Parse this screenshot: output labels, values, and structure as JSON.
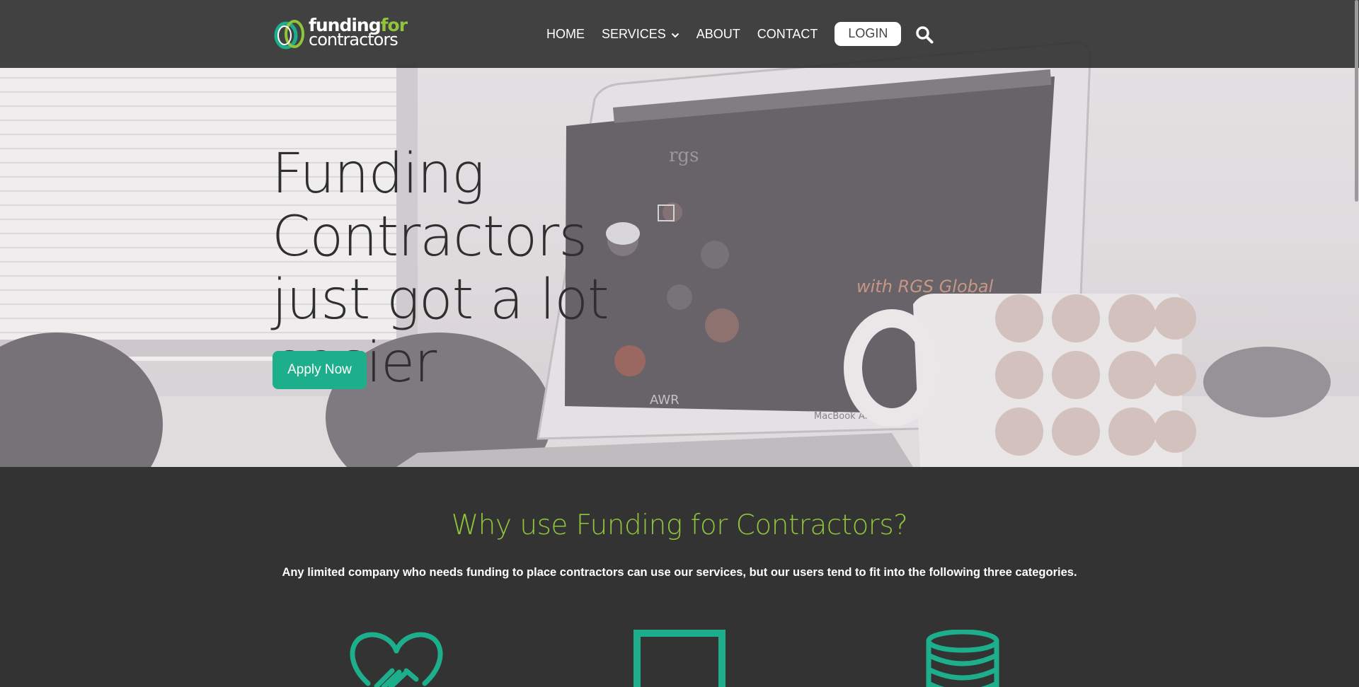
{
  "header": {
    "logo": {
      "word1": "funding",
      "word2": "for",
      "word3": "contractors"
    },
    "nav": [
      {
        "label": "HOME"
      },
      {
        "label": "SERVICES"
      },
      {
        "label": "ABOUT"
      },
      {
        "label": "CONTACT"
      }
    ],
    "login_label": "LOGIN",
    "icons": {
      "search": "search-icon",
      "dropdown": "chevron-down-icon"
    }
  },
  "hero": {
    "title_lines": [
      "Funding Contractors",
      "just got a lot",
      "easier"
    ],
    "apply_label": "Apply Now",
    "photo_texts": {
      "screen_logo": "rgs",
      "screen_tagline": "with RGS Global",
      "screen_badge": "AWR",
      "laptop_model": "MacBook Air"
    }
  },
  "why": {
    "title": "Why use Funding for Contractors?",
    "subtitle": "Any limited company who needs funding to place contractors can use our services, but our users tend to fit into the following three categories.",
    "category_icons": [
      "handshake-heart-icon",
      "square-frame-icon",
      "database-stack-icon"
    ]
  },
  "colors": {
    "accent_green": "#1daf8c",
    "lime": "#8fc43b",
    "dark_bg": "#333333",
    "header_bg": "#333333"
  }
}
